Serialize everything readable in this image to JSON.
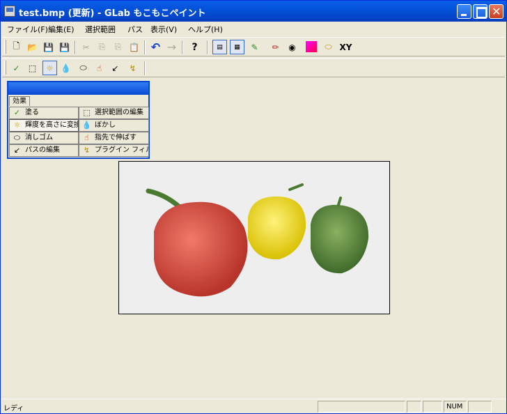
{
  "window": {
    "title": "test.bmp (更新) - GLab もこもこペイント"
  },
  "menu": [
    {
      "label": "ファイル(F)"
    },
    {
      "label": "編集(E)"
    },
    {
      "label": "選択範囲"
    },
    {
      "label": "パス"
    },
    {
      "label": "表示(V)"
    },
    {
      "label": "ヘルプ(H)"
    }
  ],
  "toolbar": {
    "xy_label": "XY",
    "help_label": "?"
  },
  "palette": {
    "tab_label": "効果",
    "items": [
      {
        "label": "塗る",
        "icon": "brush-icon"
      },
      {
        "label": "選択範囲の編集",
        "icon": "selection-icon"
      },
      {
        "label": "輝度を高さに変換",
        "icon": "sun-icon"
      },
      {
        "label": "ぼかし",
        "icon": "drop-icon"
      },
      {
        "label": "消しゴム",
        "icon": "eraser-icon"
      },
      {
        "label": "指先で伸ばす",
        "icon": "finger-icon"
      },
      {
        "label": "パスの編集",
        "icon": "path-icon"
      },
      {
        "label": "プラグイン フィルター",
        "icon": "plugin-icon"
      }
    ]
  },
  "status": {
    "text": "レディ",
    "num": "NUM"
  },
  "colors": {
    "accent": "#0a4ad4",
    "background": "#ece9d8"
  }
}
